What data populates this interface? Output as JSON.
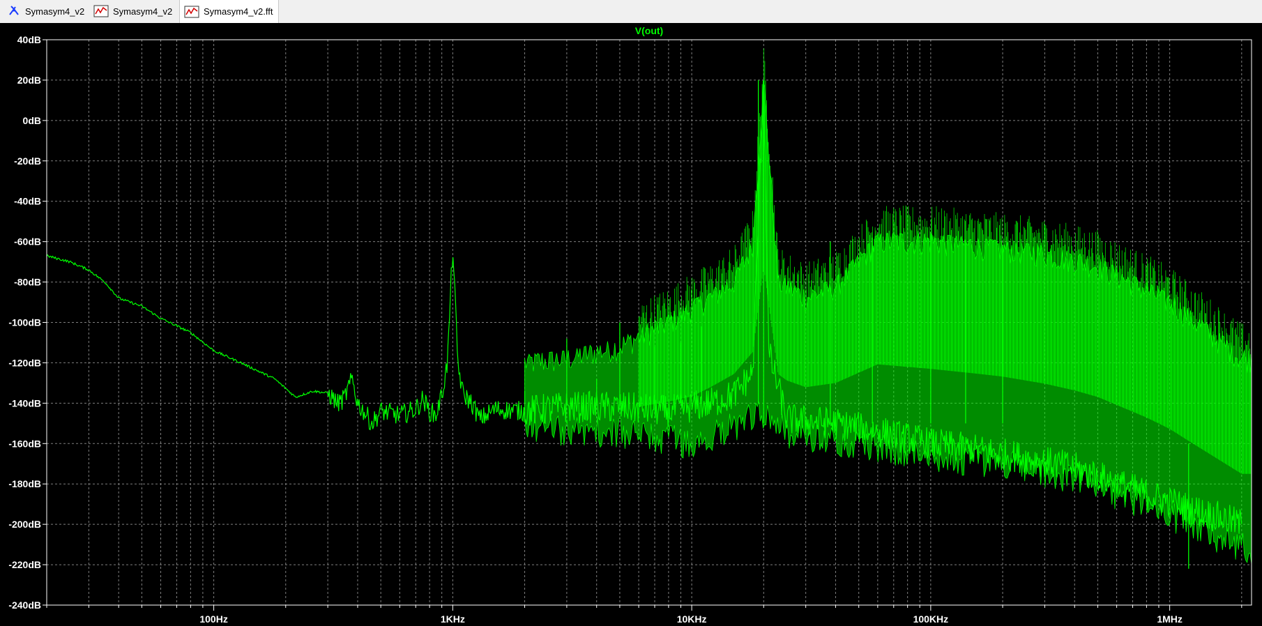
{
  "tabs": [
    {
      "label": "Symasym4_v2",
      "icon": "schematic-icon"
    },
    {
      "label": "Symasym4_v2",
      "icon": "waveform-icon"
    },
    {
      "label": "Symasym4_v2.fft",
      "icon": "waveform-icon",
      "active": true
    }
  ],
  "colors": {
    "background": "#000000",
    "trace": "#00ff00",
    "grid": "#7f7f7f",
    "axis_text": "#ffffff"
  },
  "chart_data": {
    "type": "line",
    "title": "V(out)",
    "x_scale": "log",
    "xlim_hz": [
      20,
      2200000
    ],
    "ylim_db": [
      -240,
      40
    ],
    "grid": true,
    "dashed_grid": true,
    "x_ticks": [
      {
        "value": 100,
        "label": "100Hz"
      },
      {
        "value": 1000,
        "label": "1KHz"
      },
      {
        "value": 10000,
        "label": "10KHz"
      },
      {
        "value": 100000,
        "label": "100KHz"
      },
      {
        "value": 1000000,
        "label": "1MHz"
      }
    ],
    "y_ticks": [
      {
        "value": 40,
        "label": "40dB"
      },
      {
        "value": 20,
        "label": "20dB"
      },
      {
        "value": 0,
        "label": "0dB"
      },
      {
        "value": -20,
        "label": "-20dB"
      },
      {
        "value": -40,
        "label": "-40dB"
      },
      {
        "value": -60,
        "label": "-60dB"
      },
      {
        "value": -80,
        "label": "-80dB"
      },
      {
        "value": -100,
        "label": "-100dB"
      },
      {
        "value": -120,
        "label": "-120dB"
      },
      {
        "value": -140,
        "label": "-140dB"
      },
      {
        "value": -160,
        "label": "-160dB"
      },
      {
        "value": -180,
        "label": "-180dB"
      },
      {
        "value": -200,
        "label": "-200dB"
      },
      {
        "value": -220,
        "label": "-220dB"
      },
      {
        "value": -240,
        "label": "-240dB"
      }
    ],
    "series": [
      {
        "name": "V(out)",
        "points": [
          [
            20,
            -67
          ],
          [
            25,
            -70
          ],
          [
            30,
            -74
          ],
          [
            35,
            -80
          ],
          [
            40,
            -88
          ],
          [
            50,
            -92
          ],
          [
            60,
            -98
          ],
          [
            80,
            -105
          ],
          [
            100,
            -114
          ],
          [
            130,
            -120
          ],
          [
            180,
            -128
          ],
          [
            220,
            -137
          ],
          [
            260,
            -134
          ],
          [
            300,
            -135
          ],
          [
            330,
            -140
          ],
          [
            350,
            -138
          ],
          [
            380,
            -128
          ],
          [
            400,
            -140
          ],
          [
            430,
            -145
          ],
          [
            460,
            -150
          ],
          [
            500,
            -144
          ],
          [
            600,
            -146
          ],
          [
            700,
            -143
          ],
          [
            750,
            -138
          ],
          [
            800,
            -144
          ],
          [
            850,
            -146
          ],
          [
            900,
            -136
          ],
          [
            950,
            -120
          ],
          [
            1000,
            -62
          ],
          [
            1050,
            -120
          ],
          [
            1100,
            -135
          ],
          [
            1200,
            -140
          ],
          [
            1300,
            -148
          ],
          [
            1500,
            -143
          ],
          [
            2000,
            -144
          ],
          [
            3000,
            -142
          ],
          [
            5000,
            -142
          ],
          [
            8000,
            -144
          ],
          [
            12000,
            -140
          ],
          [
            15000,
            -136
          ],
          [
            18000,
            -125
          ],
          [
            20000,
            20
          ],
          [
            21000,
            -115
          ],
          [
            25000,
            -148
          ],
          [
            40000,
            -150
          ],
          [
            60000,
            -154
          ],
          [
            100000,
            -160
          ],
          [
            200000,
            -165
          ],
          [
            400000,
            -172
          ],
          [
            800000,
            -185
          ],
          [
            1200000,
            -192
          ],
          [
            2000000,
            -200
          ]
        ],
        "upper_envelope": [
          [
            2000,
            -120
          ],
          [
            3000,
            -118
          ],
          [
            5000,
            -112
          ],
          [
            8000,
            -100
          ],
          [
            12000,
            -88
          ],
          [
            15000,
            -80
          ],
          [
            18000,
            -62
          ],
          [
            20000,
            20
          ],
          [
            23000,
            -80
          ],
          [
            30000,
            -88
          ],
          [
            40000,
            -82
          ],
          [
            60000,
            -60
          ],
          [
            100000,
            -60
          ],
          [
            150000,
            -62
          ],
          [
            300000,
            -66
          ],
          [
            500000,
            -72
          ],
          [
            1000000,
            -90
          ],
          [
            2000000,
            -118
          ]
        ],
        "lower_envelope": [
          [
            2000,
            -152
          ],
          [
            5000,
            -155
          ],
          [
            10000,
            -160
          ],
          [
            20000,
            -145
          ],
          [
            25000,
            -155
          ],
          [
            40000,
            -158
          ],
          [
            100000,
            -166
          ],
          [
            200000,
            -170
          ],
          [
            400000,
            -178
          ],
          [
            800000,
            -190
          ],
          [
            1200000,
            -200
          ],
          [
            2000000,
            -212
          ]
        ],
        "harmonic_spikes": [
          {
            "freq": 2000,
            "db": -134
          },
          {
            "freq": 3000,
            "db": -108
          },
          {
            "freq": 4000,
            "db": -128
          },
          {
            "freq": 5000,
            "db": -100
          },
          {
            "freq": 7000,
            "db": -112
          },
          {
            "freq": 9000,
            "db": -110
          },
          {
            "freq": 11000,
            "db": -102
          },
          {
            "freq": 19000,
            "db": 20
          },
          {
            "freq": 20000,
            "db": 20
          },
          {
            "freq": 38000,
            "db": -60
          },
          {
            "freq": 57000,
            "db": -58
          },
          {
            "freq": 100000,
            "db": -56
          },
          {
            "freq": 140000,
            "db": -60
          },
          {
            "freq": 200000,
            "db": -62
          },
          {
            "freq": 1200000,
            "db": -222
          }
        ]
      }
    ]
  }
}
